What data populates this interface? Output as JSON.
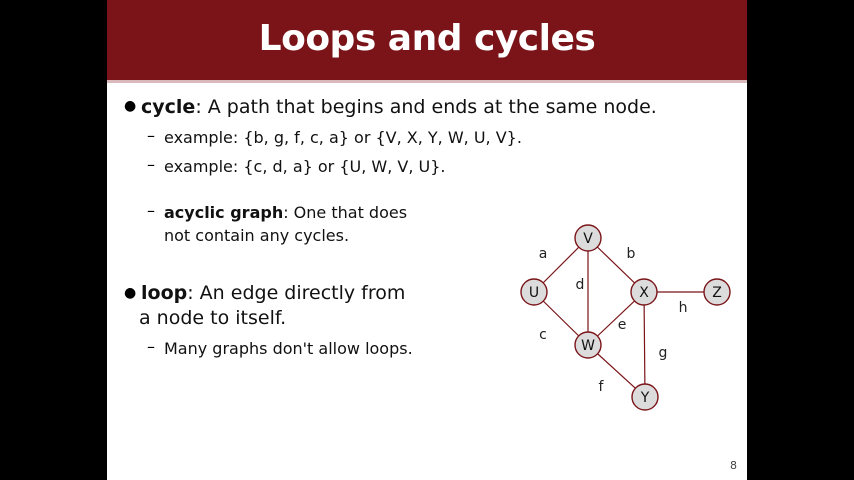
{
  "title": "Loops and cycles",
  "cycle": {
    "term": "cycle",
    "rest": ": A path that begins and ends at the same node.",
    "example1": "example: {b, g, f, c, a} or {V, X, Y, W, U, V}.",
    "example2": "example: {c, d, a} or {U, W, V, U}.",
    "acyclic_term": "acyclic graph",
    "acyclic_rest": ": One that does",
    "acyclic_line2": "not contain any cycles."
  },
  "loop": {
    "term": "loop",
    "rest": ": An edge directly from",
    "line2": "a node to itself.",
    "sub": "Many graphs don't allow loops."
  },
  "graph": {
    "nodes": {
      "V": "V",
      "U": "U",
      "X": "X",
      "Z": "Z",
      "W": "W",
      "Y": "Y"
    },
    "edges": {
      "a": "a",
      "b": "b",
      "c": "c",
      "d": "d",
      "e": "e",
      "f": "f",
      "g": "g",
      "h": "h"
    },
    "node_fill": "#dcdcdc",
    "edge_color": "#7a1418"
  },
  "page_number": "8"
}
